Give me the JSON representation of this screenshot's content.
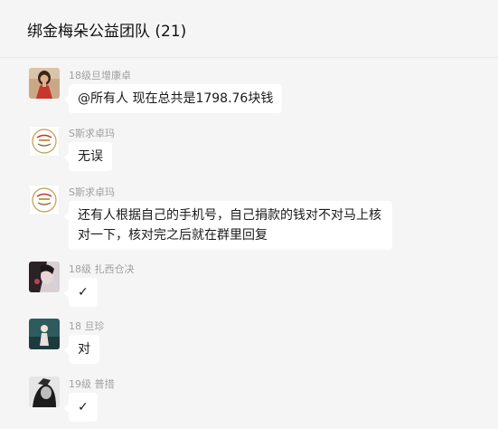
{
  "chat": {
    "title": "绑金梅朵公益团队 (21)"
  },
  "messages": [
    {
      "sender": "18级旦增康卓",
      "text": "@所有人 现在总共是1798.76块钱",
      "avatar": "avatar-girl-red-dress"
    },
    {
      "sender": "S斯求卓玛",
      "text": "无误",
      "avatar": "avatar-logo-emblem"
    },
    {
      "sender": "S斯求卓玛",
      "text": "还有人根据自己的手机号，自己捐款的钱对不对马上核对一下，核对完之后就在群里回复",
      "avatar": "avatar-logo-emblem"
    },
    {
      "sender": "18级 扎西仓决",
      "text": "✓",
      "avatar": "avatar-portrait-dark"
    },
    {
      "sender": "18 旦珍",
      "text": "对",
      "avatar": "avatar-figure-teal"
    },
    {
      "sender": "19级   普措",
      "text": "✓",
      "avatar": "avatar-portrait-bw"
    }
  ]
}
